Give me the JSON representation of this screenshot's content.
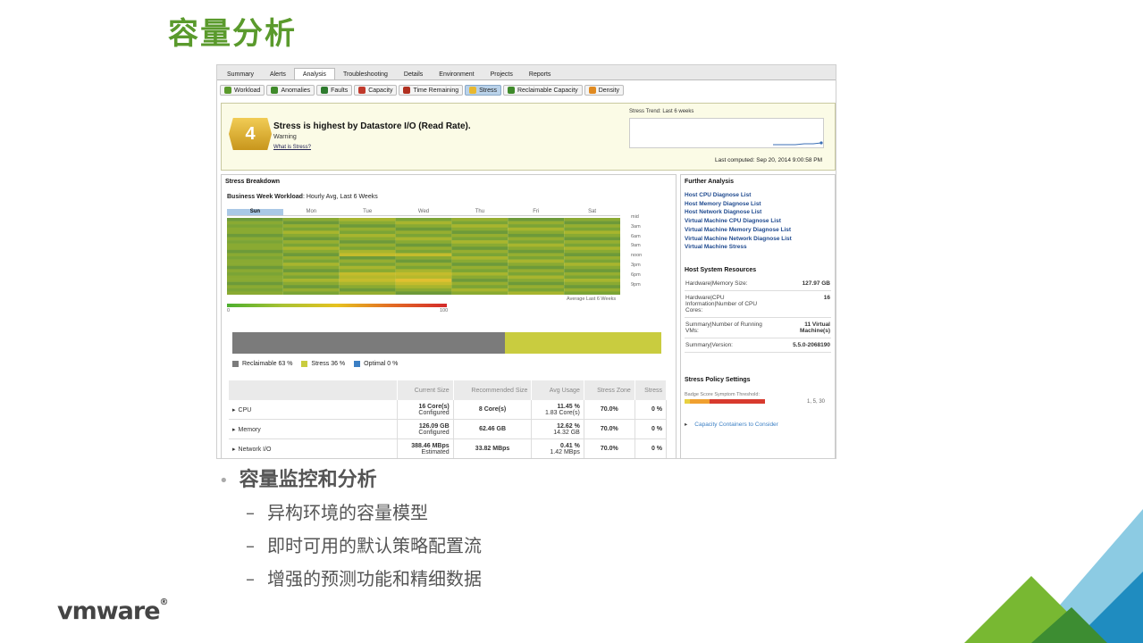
{
  "slide": {
    "title": "容量分析",
    "bullets": [
      "容量监控和分析"
    ],
    "sub_bullets": [
      "异构环境的容量模型",
      "即时可用的默认策略配置流",
      "增强的预测功能和精细数据"
    ],
    "logo": {
      "text": "vmware",
      "mark": "®"
    }
  },
  "tabs": [
    {
      "label": "Summary"
    },
    {
      "label": "Alerts"
    },
    {
      "label": "Analysis",
      "active": true
    },
    {
      "label": "Troubleshooting"
    },
    {
      "label": "Details"
    },
    {
      "label": "Environment"
    },
    {
      "label": "Projects"
    },
    {
      "label": "Reports"
    }
  ],
  "subtabs": [
    {
      "label": "Workload",
      "icon": "workload-icon",
      "color": "#5a9a2c"
    },
    {
      "label": "Anomalies",
      "icon": "anomalies-icon",
      "color": "#3f8a2a"
    },
    {
      "label": "Faults",
      "icon": "faults-icon",
      "color": "#2e7b2e"
    },
    {
      "label": "Capacity",
      "icon": "capacity-icon",
      "color": "#c0392b"
    },
    {
      "label": "Time Remaining",
      "icon": "time-remaining-icon",
      "color": "#b03020"
    },
    {
      "label": "Stress",
      "icon": "stress-icon",
      "color": "#e8b830",
      "active": true
    },
    {
      "label": "Reclaimable Capacity",
      "icon": "reclaimable-icon",
      "color": "#3f8a2a"
    },
    {
      "label": "Density",
      "icon": "density-icon",
      "color": "#e08a20"
    }
  ],
  "alert": {
    "badge": "4",
    "heading": "Stress is highest by Datastore I/O (Read Rate).",
    "status": "Warning",
    "link": "What is Stress?",
    "trend_title": "Stress Trend: Last 6 weeks",
    "last_computed": "Last computed: Sep 20, 2014 9:00:58 PM"
  },
  "breakdown": {
    "title": "Stress Breakdown",
    "workload_label": "Business Week Workload",
    "workload_suffix": ": Hourly Avg, Last 6 Weeks",
    "days": [
      "Sun",
      "Mon",
      "Tue",
      "Wed",
      "Thu",
      "Fri",
      "Sat"
    ],
    "hours": [
      "mid",
      "3am",
      "6am",
      "9am",
      "noon",
      "3pm",
      "6pm",
      "9pm"
    ],
    "avg_label": "Average Last 6 Weeks",
    "scale_min": "0",
    "scale_max": "100",
    "bar": [
      {
        "label": "Reclaimable 63 %",
        "value": 63,
        "color": "#7b7b7b"
      },
      {
        "label": "Stress 36 %",
        "value": 36,
        "color": "#c9cc3f"
      },
      {
        "label": "Optimal 0 %",
        "value": 0,
        "color": "#3b7fc4"
      }
    ]
  },
  "table": {
    "headers": [
      "",
      "Current Size",
      "Recommended Size",
      "Avg Usage",
      "Stress Zone",
      "Stress"
    ],
    "rows": [
      {
        "name": "CPU",
        "current": "16 Core(s)",
        "current_sub": "Configured",
        "recommended": "8 Core(s)",
        "usage": "11.45 %",
        "usage_sub": "1.83 Core(s)",
        "zone": "70.0%",
        "stress": "0 %"
      },
      {
        "name": "Memory",
        "current": "126.09 GB",
        "current_sub": "Configured",
        "recommended": "62.46 GB",
        "usage": "12.62 %",
        "usage_sub": "14.32 GB",
        "zone": "70.0%",
        "stress": "0 %"
      },
      {
        "name": "Network I/O",
        "current": "388.46 MBps",
        "current_sub": "Estimated",
        "recommended": "33.82 MBps",
        "usage": "0.41 %",
        "usage_sub": "1.42 MBps",
        "zone": "70.0%",
        "stress": "0 %"
      }
    ]
  },
  "further": {
    "title": "Further Analysis",
    "links": [
      "Host CPU Diagnose List",
      "Host Memory Diagnose List",
      "Host Network Diagnose List",
      "Virtual Machine CPU Diagnose List",
      "Virtual Machine Memory Diagnose List",
      "Virtual Machine Network Diagnose List",
      "Virtual Machine Stress"
    ]
  },
  "resources": {
    "title": "Host System Resources",
    "rows": [
      {
        "label": "Hardware|Memory Size:",
        "value": "127.97 GB"
      },
      {
        "label": "Hardware|CPU Information|Number of CPU Cores:",
        "value": "16"
      },
      {
        "label": "Summary|Number of Running VMs:",
        "value": "11 Virtual Machine(s)"
      },
      {
        "label": "Summary|Version:",
        "value": "5.5.0-2068190"
      }
    ]
  },
  "policy": {
    "title": "Stress Policy Settings",
    "threshold_label": "Badge Score Symptom Threshold:",
    "threshold_values": "1, 5, 30",
    "containers_link": "Capacity Containers to Consider"
  }
}
